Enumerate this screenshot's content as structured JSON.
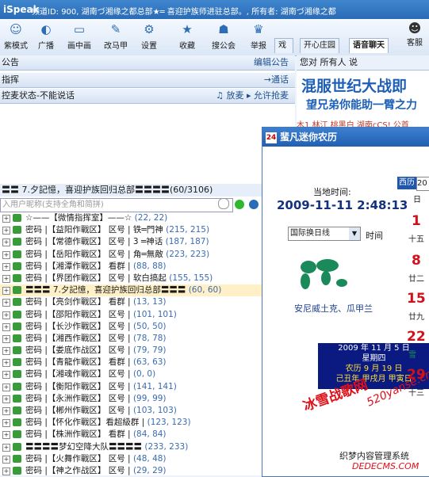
{
  "titlebar": {
    "app_name": "iSpeak",
    "info_text": "频道ID: 900, 湖南づ湘缘之都总部★═ 喜迎护族师进驻总部。, 所有者: 湖南づ湘缘之都"
  },
  "toolbar": {
    "items": [
      {
        "label": "紫模式",
        "icon": "face-icon"
      },
      {
        "label": "广播",
        "icon": "broadcast-icon"
      },
      {
        "label": "画中画",
        "icon": "screen-icon"
      },
      {
        "label": "改马甲",
        "icon": "edit-icon"
      },
      {
        "label": "设置",
        "icon": "gear-icon"
      },
      {
        "label": "收藏",
        "icon": "star-icon"
      },
      {
        "label": "搜公会",
        "icon": "people-icon"
      },
      {
        "label": "举报",
        "icon": "police-icon"
      }
    ],
    "tabs": [
      "戏",
      "开心庄园",
      "语音聊天"
    ],
    "active_tab": "语音聊天",
    "kefu_label": "客服"
  },
  "left": {
    "announcement_label": "公告",
    "edit_announcement": "编辑公告",
    "command_label": "指挥",
    "to_link": "→通话",
    "control_status": "控麦状态-不能说话",
    "mic_release": "放麦",
    "allow_grab": "允许抢麦"
  },
  "right": {
    "chat_header": "您对 所有人 说",
    "banner_line1": "混服世纪大战即",
    "banner_line2": "望兄弟你能助一臂之力",
    "banner_line3": "木1 林江 桃黑白 湖南cCS! 公首"
  },
  "channel": {
    "header": "〓〓 7.夕記憶，喜迎护族回归总部〓〓〓〓(60/3106)",
    "search_placeholder": "入用户昵称(支持全角和简拼)",
    "rows": [
      {
        "name": "☆——【微情指挥室】——☆",
        "count": "(22, 22)",
        "highlight": false
      },
      {
        "name": "密码 |【益阳作戰区】  区号 | 铁═門神",
        "count": "(215, 215)",
        "highlight": false
      },
      {
        "name": "密码 |【常德作戰区】  区号 | 3 ═神话",
        "count": "(187, 187)",
        "highlight": false
      },
      {
        "name": "密码 |【岳阳作戰区】  区号 | 角═無敵",
        "count": "(223, 223)",
        "highlight": false
      },
      {
        "name": "密码 |【湘潭作戰区】  看群 |",
        "count": "(88, 88)",
        "highlight": false
      },
      {
        "name": "密码 |【界团作戰区】  区号 | 软白搞起",
        "count": "(155, 155)",
        "highlight": false
      },
      {
        "name": "〓〓〓 7.夕記憶，喜迎护族回归总部〓〓〓",
        "count": "(60, 60)",
        "highlight": true
      },
      {
        "name": "密码 |【亮剑作戰区】  看群 |",
        "count": "(13, 13)",
        "highlight": false
      },
      {
        "name": "密码 |【邵阳作戰区】  区号 |",
        "count": "(101, 101)",
        "highlight": false
      },
      {
        "name": "密码 |【长沙作戰区】  区号 |",
        "count": "(50, 50)",
        "highlight": false
      },
      {
        "name": "密码 |【湘西作戰区】  区号 |",
        "count": "(78, 78)",
        "highlight": false
      },
      {
        "name": "密码 |【娄底作战区】  区号 |",
        "count": "(79, 79)",
        "highlight": false
      },
      {
        "name": "密码 |【青龍作戰区】  看群 |",
        "count": "(63, 63)",
        "highlight": false
      },
      {
        "name": "密码 |【湘魂作戰区】  区号 |",
        "count": "(0, 0)",
        "highlight": false
      },
      {
        "name": "密码 |【衡阳作戰区】  区号 |",
        "count": "(141, 141)",
        "highlight": false
      },
      {
        "name": "密码 |【永洲作戰区】  区号 |",
        "count": "(99, 99)",
        "highlight": false
      },
      {
        "name": "密码 |【郴州作戰区】  区号 |",
        "count": "(103, 103)",
        "highlight": false
      },
      {
        "name": "密码 |【怀化作戰区】看超級群 |",
        "count": "(123, 123)",
        "highlight": false
      },
      {
        "name": "密码 |【株洲作戰区】  看群 |",
        "count": "(84, 84)",
        "highlight": false
      },
      {
        "name": "〓〓〓〓梦幻空降大队〓〓〓〓",
        "count": "(233, 233)",
        "highlight": false
      },
      {
        "name": "密码 |【火舞作戰区】  区号 |",
        "count": "(48, 48)",
        "highlight": false
      },
      {
        "name": "密码 |【神之作战区】  区号 |",
        "count": "(29, 29)",
        "highlight": false
      }
    ]
  },
  "dialog": {
    "title": "蜚凡迷你农历",
    "current_time_label": "当地时间:",
    "current_time": "2009-11-11 2:48:13",
    "timezone_select": "国际换日线",
    "time_label": "时间",
    "city": "安尼威土克、瓜甲兰",
    "lunar_date": "2009 年 11 月 5 日",
    "lunar_weekday": "星期四",
    "lunar_calendar": "农历 9 月 19 日",
    "lunar_ganzhi": "己丑年 甲戌月 甲寅日",
    "cal_west_label": "西历",
    "cal_year_fragment": "20",
    "cal_week_header": "日",
    "cal_days": [
      {
        "day": "1",
        "lunar": "十五"
      },
      {
        "day": "8",
        "lunar": "廿二"
      },
      {
        "day": "15",
        "lunar": "廿九"
      },
      {
        "day": "22",
        "lunar": "雪"
      },
      {
        "day": "29",
        "lunar": "十三"
      }
    ]
  },
  "watermark": {
    "brand": "冰雪战歌网",
    "url": "520yanse.cn",
    "site_cn": "织梦内容管理系统",
    "site_en": "DEDECMS.COM"
  },
  "colors": {
    "titlebar": "#2a6bb5",
    "accent": "#1d5fb6",
    "red": "#d0101a"
  }
}
